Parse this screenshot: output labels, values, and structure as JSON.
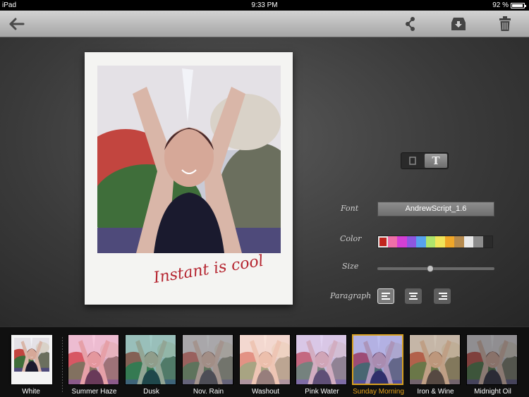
{
  "status_bar": {
    "device": "iPad",
    "time": "9:33 PM",
    "battery": "92 %",
    "battery_level": 0.92
  },
  "toolbar": {
    "back_icon": "arrow-left-icon",
    "share_icon": "share-icon",
    "save_icon": "tray-download-icon",
    "delete_icon": "trash-icon"
  },
  "photo": {
    "caption": "Instant is cool"
  },
  "editor": {
    "mode_options": [
      "frame-mode-icon",
      "text-mode-icon"
    ],
    "mode_text_glyph": "T",
    "active_mode": "text",
    "font_label": "Font",
    "font_value": "AndrewScript_1.6",
    "color_label": "Color",
    "colors": [
      "#c1241d",
      "#ef6fa8",
      "#d43fd4",
      "#8d57e0",
      "#57a2ee",
      "#aee46c",
      "#f0e55a",
      "#f0a728",
      "#b58a4e",
      "#e9e9e9",
      "#8c8c8c",
      "#2b2b2b"
    ],
    "selected_color": "#c1241d",
    "size_label": "Size",
    "size_value": 0.45,
    "paragraph_label": "Paragraph",
    "paragraph_options": [
      "align-left-icon",
      "align-center-icon",
      "align-right-icon"
    ],
    "selected_paragraph": "left"
  },
  "filters": [
    {
      "name": "White",
      "selected": false
    },
    {
      "name": "Summer Haze",
      "selected": false
    },
    {
      "name": "Dusk",
      "selected": false
    },
    {
      "name": "Nov. Rain",
      "selected": false
    },
    {
      "name": "Washout",
      "selected": false
    },
    {
      "name": "Pink Water",
      "selected": false
    },
    {
      "name": "Sunday Morning",
      "selected": true
    },
    {
      "name": "Iron & Wine",
      "selected": false
    },
    {
      "name": "Midnight Oil",
      "selected": false
    }
  ]
}
